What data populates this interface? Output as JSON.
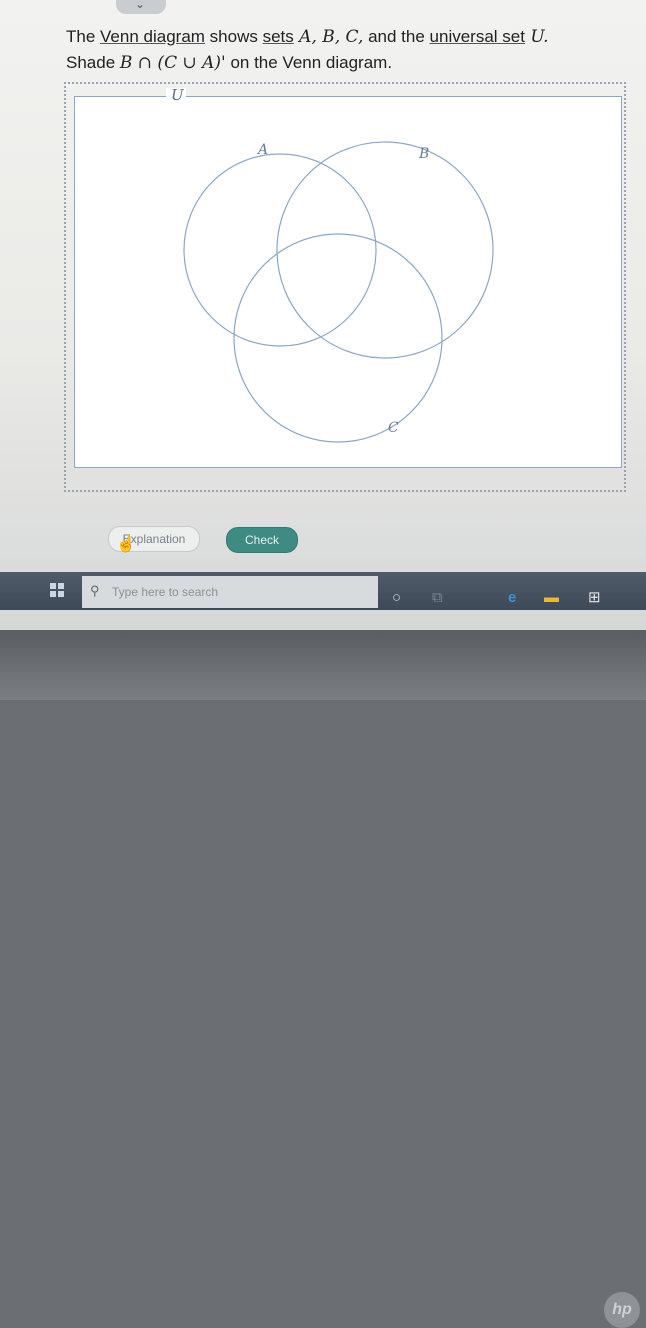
{
  "question": {
    "line1_pre": "The ",
    "venn_link": "Venn diagram",
    "line1_mid": " shows ",
    "sets_link": "sets",
    "line1_sets": " A, B, C,",
    "line1_and": " and the ",
    "universal_link": "universal set",
    "line1_u": " U.",
    "line2_pre": "Shade ",
    "expression": "B ∩ (C ∪ A)'",
    "line2_post": " on the Venn diagram."
  },
  "venn": {
    "universe_label": "U",
    "set_labels": {
      "a": "A",
      "b": "B",
      "c": "C"
    },
    "stroke_color": "#8aa6c8"
  },
  "buttons": {
    "explanation": "Explanation",
    "check": "Check"
  },
  "taskbar": {
    "search_placeholder": "Type here to search"
  },
  "colors": {
    "check_button": "#3d8b82",
    "taskbar": "#46525f"
  }
}
